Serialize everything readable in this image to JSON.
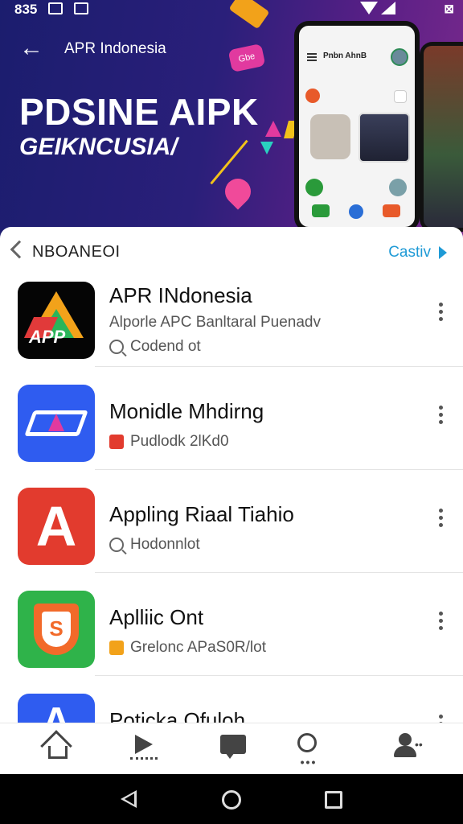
{
  "status_bar": {
    "time": "835",
    "right_text": "⊠"
  },
  "hero": {
    "app_name": "APR Indonesia",
    "title": "PDSINE AIPK",
    "subtitle": "GEIKNCUSIA/",
    "tag_text": "Gbe",
    "phone_title": "Pnbn AhnB"
  },
  "section": {
    "label": "NBOANEOI",
    "link": "Castiv"
  },
  "apps": [
    {
      "name": "APR INdonesia",
      "subtitle": "Alporle APC Banltaral Puenadv",
      "meta": "Codend ot",
      "icon_text": "APP",
      "accent": "#050505"
    },
    {
      "name": "Monidle Mhdirng",
      "meta": "Pudlodk 2lKd0",
      "accent": "#2f5cf0",
      "badge_color": "#e23b2e"
    },
    {
      "name": "Appling Riaal Tiahio",
      "meta": "Hodonnlot",
      "icon_text": "A",
      "accent": "#e23b2e"
    },
    {
      "name": "Aplliic Ont",
      "meta": "Grelonc APaS0R/lot",
      "icon_text": "S",
      "accent": "#2fb34a",
      "badge_color": "#f2a21a"
    },
    {
      "name": "Poticka Ofuloh",
      "icon_text": "A",
      "accent": "#2f5cf0"
    }
  ],
  "colors": {
    "link": "#1e9ad6",
    "hero_start": "#1b1d6e",
    "hero_end": "#7a2a8c"
  }
}
